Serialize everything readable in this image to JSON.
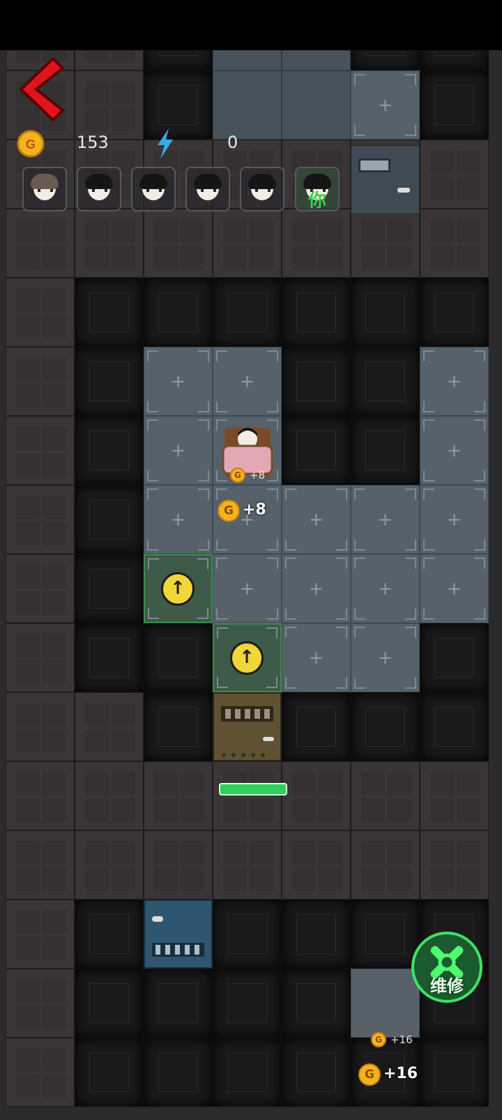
{
  "hud": {
    "coins": "153",
    "energy": "0",
    "back_icon": "back-arrow-icon",
    "coin_icon": "gold-coin-icon",
    "energy_icon": "lightning-icon"
  },
  "portraits": [
    {
      "name": "portrait-1",
      "you": false
    },
    {
      "name": "portrait-2",
      "you": false
    },
    {
      "name": "portrait-3",
      "you": false
    },
    {
      "name": "portrait-4",
      "you": false
    },
    {
      "name": "portrait-5",
      "you": false
    },
    {
      "name": "portrait-6",
      "you": true,
      "label": "你"
    }
  ],
  "tile_plus": "+",
  "coin_glyph": "G",
  "income": {
    "bed_float_small": "+8",
    "bed_float_big": "+8",
    "bottom_float_small": "+16",
    "bottom_float_big": "+16"
  },
  "upgrade_glyph": "↑",
  "repair": {
    "label": "维修",
    "icon": "wrench-gear-icon"
  },
  "door": {
    "health_fraction": 1.0
  },
  "colors": {
    "accent_green": "#3ee463",
    "coin": "#f3b320",
    "back_red": "#e0141c",
    "energy_blue": "#3aa9e8"
  }
}
